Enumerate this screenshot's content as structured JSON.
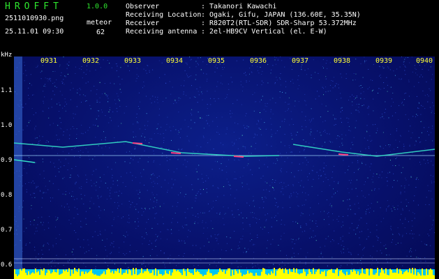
{
  "header": {
    "app_title": "HROFFT",
    "app_version": "1.0.0",
    "file_name": "2511010930.png",
    "date_time": "25.11.01 09:30",
    "mode_label": "meteor",
    "mode_count": "62"
  },
  "info": {
    "observer_label": "Observer",
    "observer_value": ": Takanori Kawachi",
    "location_label": "Receiving Location",
    "location_value": ": Ogaki, Gifu, JAPAN (136.60E, 35.35N)",
    "receiver_label": "Receiver",
    "receiver_value": ": R820T2(RTL-SDR) SDR-Sharp 53.372MHz",
    "antenna_label": "Receiving antenna",
    "antenna_value": ": 2el-HB9CV Vertical (el. E-W)"
  },
  "spectrogram": {
    "y_unit": "kHz",
    "y_ticks": [
      "1.1",
      "1.0",
      "0.9",
      "0.8",
      "0.7",
      "0.6"
    ],
    "x_ticks": [
      "0931",
      "0932",
      "0933",
      "0934",
      "0935",
      "0936",
      "0937",
      "0938",
      "0939",
      "0940"
    ],
    "colors": {
      "background": "#07106a",
      "trace": "#35e0c8",
      "meteor": "#ff4080",
      "baseline": "#ffff00",
      "cyan_band": "#00d8ff"
    }
  }
}
